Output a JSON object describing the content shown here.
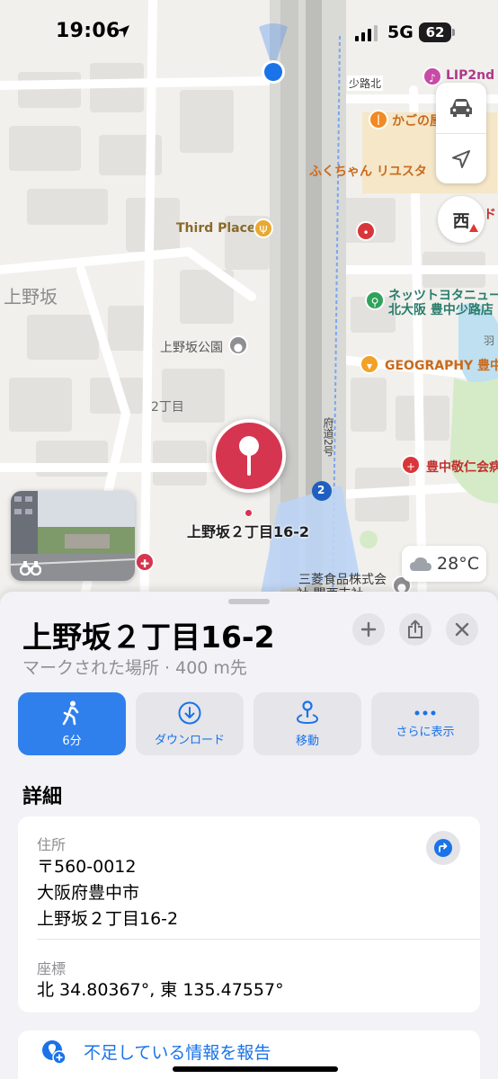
{
  "status_bar": {
    "time": "19:06",
    "network": "5G",
    "battery": "62"
  },
  "map": {
    "labels": {
      "area": "上野坂",
      "chome": "2丁目",
      "park": "上野坂公園",
      "third_place": "Third Place",
      "shoji_kita": "少路北",
      "kagono": "かごの屋",
      "fukuchan": "ふくちゃん リユスタ",
      "netz": "ネッツトヨタニュー",
      "netz2": "北大阪 豊中少路店",
      "geography": "GEOGRAPHY 豊中",
      "hospital": "豊中敬仁会病",
      "road": "府道2号",
      "road_num": "2",
      "mitsubishi": "三菱食品株式会",
      "mitsubishi2": "社 関西支社",
      "lip": "LIP2nd",
      "uwa": "羽",
      "do": "ド"
    },
    "compass": "西",
    "weather": "28°C",
    "marker_label": "上野坂２丁目16-2"
  },
  "sheet": {
    "title": "上野坂２丁目16-2",
    "subtitle": "マークされた場所 · 400 m先",
    "actions": [
      {
        "label": "6分",
        "icon": "walk-icon"
      },
      {
        "label": "ダウンロード",
        "icon": "download-icon"
      },
      {
        "label": "移動",
        "icon": "move-icon"
      },
      {
        "label": "さらに表示",
        "icon": "more-icon"
      }
    ],
    "details_header": "詳細",
    "address_label": "住所",
    "address_lines": [
      "〒560-0012",
      "大阪府豊中市",
      "上野坂２丁目16-2"
    ],
    "coords_label": "座標",
    "coords_value": "北 34.80367°, 東 135.47557°",
    "report": "不足している情報を報告"
  },
  "colors": {
    "accent": "#2f80ed",
    "marker": "#d6354f",
    "link": "#1a73e8"
  }
}
